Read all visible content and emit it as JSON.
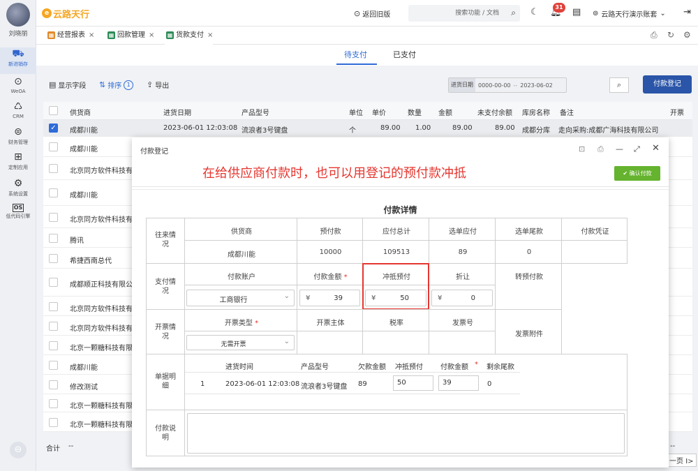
{
  "user": {
    "name": "刘晓丽"
  },
  "nav": {
    "items": [
      {
        "label": "新进销存",
        "icon": "truck-icon"
      },
      {
        "label": "WeOA",
        "icon": "gear-circle-icon"
      },
      {
        "label": "CRM",
        "icon": "crm-icon"
      },
      {
        "label": "财务管理",
        "icon": "finance-icon"
      },
      {
        "label": "定制应用",
        "icon": "grid-icon"
      },
      {
        "label": "系统设置",
        "icon": "settings-icon"
      },
      {
        "label": "低代码引擎",
        "icon": "os-icon"
      }
    ],
    "os_text": "OS"
  },
  "topbar": {
    "logo_cn": "云路天行",
    "back_label": "返回旧版",
    "search_placeholder": "搜索功能 / 文档",
    "notification_count": "31",
    "company": "云路天行演示账套"
  },
  "tabs": [
    {
      "label": "经营报表",
      "color": "#e08a2c"
    },
    {
      "label": "回款管理",
      "color": "#2e8b57"
    },
    {
      "label": "货款支付",
      "color": "#2e8b57"
    }
  ],
  "subtabs": {
    "pending": "待支付",
    "paid": "已支付"
  },
  "toolbar": {
    "show_fields": "显示字段",
    "sort": "排序",
    "sort_count": "1",
    "export": "导出",
    "date_label": "进货日期",
    "date_from": "0000-00-00",
    "date_sep": "--",
    "date_to": "2023-06-02",
    "pay_button": "付款登记"
  },
  "table": {
    "headers": [
      "供货商",
      "进货日期",
      "产品型号",
      "单位",
      "单价",
      "数量",
      "金额",
      "未支付余额",
      "库房名称",
      "备注",
      "开票"
    ],
    "first_row": {
      "supplier": "成都川能",
      "date": "2023-06-01 12:03:08",
      "model": "流浪者3号键盘",
      "unit": "个",
      "price": "89.00",
      "qty": "1.00",
      "amount": "89.00",
      "unpaid": "89.00",
      "warehouse": "成都分库",
      "note": "走向采购:成都广海科技有限公司"
    },
    "suppliers": [
      "成都川能",
      "北京同方软件科技有",
      "成都川能",
      "北京同方软件科技有",
      "腾讯",
      "希捷西南总代",
      "成都顺正科技有限公",
      "北京同方软件科技有",
      "北京同方软件科技有",
      "北京一颗糖科技有限",
      "成都川能",
      "修改测试",
      "北京一颗糖科技有限",
      "北京一颗糖科技有限"
    ],
    "total_label": "合计",
    "total_value": "--",
    "total_right": "--",
    "pager_label": "一页"
  },
  "modal": {
    "title": "付款登记",
    "announcement": "在给供应商付款时，也可以用登记的预付款冲抵",
    "confirm": "确认付款",
    "detail_title": "付款详情",
    "history": {
      "label": "往来情况",
      "headers": [
        "供货商",
        "预付款",
        "应付总计",
        "选单应付",
        "选单尾款",
        "付款凭证"
      ],
      "values": [
        "成都川能",
        "10000",
        "109513",
        "89",
        "0"
      ]
    },
    "payment": {
      "label": "支付情况",
      "headers": [
        "付款账户",
        "付款金额",
        "冲抵预付",
        "折让",
        "转预付款"
      ],
      "account": "工商银行",
      "amount": "39",
      "offset": "50",
      "discount": "0",
      "currency": "¥"
    },
    "invoice": {
      "label": "开票情况",
      "headers": [
        "开票类型",
        "开票主体",
        "税率",
        "发票号",
        "发票附件"
      ],
      "type": "无需开票"
    },
    "detail": {
      "label": "单据明细",
      "headers": [
        "进货时间",
        "产品型号",
        "欠款金额",
        "冲抵预付",
        "付款金额",
        "剩余尾款"
      ],
      "row": {
        "index": "1",
        "time": "2023-06-01 12:03:08",
        "model": "流浪者3号键盘",
        "debt": "89",
        "offset": "50",
        "pay": "39",
        "remain": "0"
      }
    },
    "remark_label": "付款说明"
  },
  "colors": {
    "accent": "#2f6bd8",
    "primary_button": "#2a55a8",
    "confirm": "#65b32e",
    "alert": "#e5362f",
    "logo": "#f5a623"
  }
}
